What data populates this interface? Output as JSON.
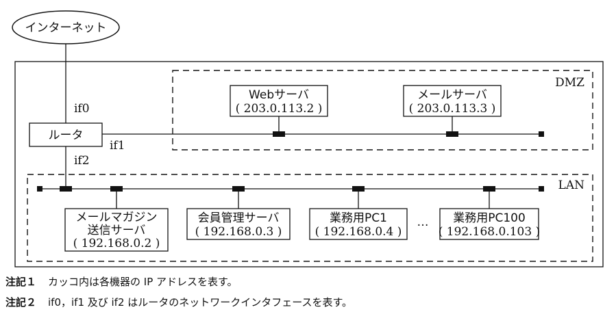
{
  "internet": "インターネット",
  "router": {
    "label": "ルータ",
    "if0": "if0",
    "if1": "if1",
    "if2": "if2"
  },
  "dmz": {
    "label": "DMZ",
    "servers": [
      {
        "name": "Webサーバ",
        "ip": "( 203.0.113.2 )"
      },
      {
        "name": "メールサーバ",
        "ip": "( 203.0.113.3 )"
      }
    ]
  },
  "lan": {
    "label": "LAN",
    "ellipsis": "…",
    "hosts": [
      {
        "lines": [
          "メールマガジン",
          "送信サーバ",
          "( 192.168.0.2 )"
        ]
      },
      {
        "lines": [
          "会員管理サーバ",
          "( 192.168.0.3 )"
        ]
      },
      {
        "lines": [
          "業務用PC1",
          "( 192.168.0.4 )"
        ]
      },
      {
        "lines": [
          "業務用PC100",
          "( 192.168.0.103 )"
        ]
      }
    ]
  },
  "notes": [
    {
      "label": "注記１",
      "text": "カッコ内は各機器の IP アドレスを表す。"
    },
    {
      "label": "注記２",
      "text": "if0，if1 及び if2 はルータのネットワークインタフェースを表す。"
    }
  ]
}
